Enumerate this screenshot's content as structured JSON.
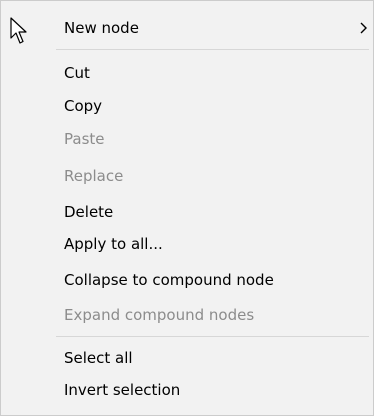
{
  "context_menu": {
    "items": [
      {
        "label": "New node",
        "enabled": true,
        "submenu": true,
        "submenu_icon": "chevron-right-icon"
      },
      {
        "label": "Cut",
        "enabled": true
      },
      {
        "label": "Copy",
        "enabled": true
      },
      {
        "label": "Paste",
        "enabled": false
      },
      {
        "label": "Replace",
        "enabled": false
      },
      {
        "label": "Delete",
        "enabled": true
      },
      {
        "label": "Apply to all...",
        "enabled": true
      },
      {
        "label": "Collapse to compound node",
        "enabled": true
      },
      {
        "label": "Expand compound nodes",
        "enabled": false
      },
      {
        "label": "Select all",
        "enabled": true
      },
      {
        "label": "Invert selection",
        "enabled": true
      }
    ]
  },
  "cursor": {
    "icon": "mouse-pointer-icon"
  },
  "colors": {
    "menu_background": "#f2f2f2",
    "menu_border": "#cccccc",
    "separator": "#d7d7d7",
    "text_enabled": "#000000",
    "text_disabled": "#8c8c8c"
  }
}
